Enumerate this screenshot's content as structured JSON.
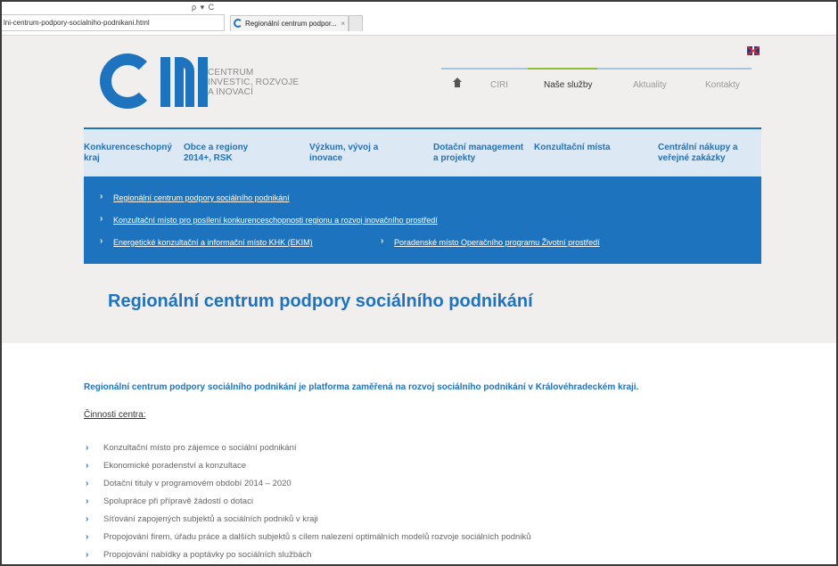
{
  "browser": {
    "url": "lni-centrum-podpory-socialniho-podnikani.html",
    "url_actions": "ρ ▾ C",
    "tab_title": "Regionální centrum podpor...",
    "tab_close": "×"
  },
  "logo": {
    "line1": "CENTRUM",
    "line2": "INVESTIC, ROZVOJE",
    "line3": "A INOVACÍ"
  },
  "main_nav": {
    "items": [
      "CIRI",
      "Naše služby",
      "Aktuality",
      "Kontakty"
    ]
  },
  "categories": [
    {
      "line1": "Konkurenceschopný",
      "line2": "kraj"
    },
    {
      "line1": "Obce a regiony",
      "line2": "2014+, RSK"
    },
    {
      "line1": "Výzkum, vývoj a",
      "line2": "inovace"
    },
    {
      "line1": "Dotační management",
      "line2": "a projekty"
    },
    {
      "line1": "Konzultační místa",
      "line2": ""
    },
    {
      "line1": "Centrální nákupy a",
      "line2": "veřejné zakázky"
    }
  ],
  "sub_links": [
    "Regionální centrum podpory sociálního podnikání",
    "Konzultační místo pro posílení konkurenceschopnosti regionu a rozvoj inovačního prostředí",
    "Energetické konzultační a informační místo KHK (EKIM)",
    "Poradenské místo Operačního programu Životní prostředí"
  ],
  "page_title": "Regionální centrum podpory sociálního podnikání",
  "intro": "Regionální centrum podpory sociálního podnikání je platforma zaměřená na rozvoj sociálního podnikání v Královéhradeckém kraji.",
  "section_title": "Činnosti centra:",
  "activities": [
    "Konzultační místo pro zájemce o sociální podnikání",
    "Ekonomické poradenství a konzultace",
    "Dotační tituly v programovém období 2014 – 2020",
    "Spolupráce při přípravě žádostí o dotaci",
    "Síťování zapojených subjektů a sociálních podniků v kraji",
    "Propojování firem, úřadu práce a dalších subjektů s cílem nalezení optimálních modelů rozvoje sociálních podniků",
    "Propojování nabídky a poptávky po sociálních službách"
  ],
  "arrow_glyph": "›",
  "colors": {
    "brand_blue": "#1e73be",
    "accent_green": "#8fbe35"
  }
}
